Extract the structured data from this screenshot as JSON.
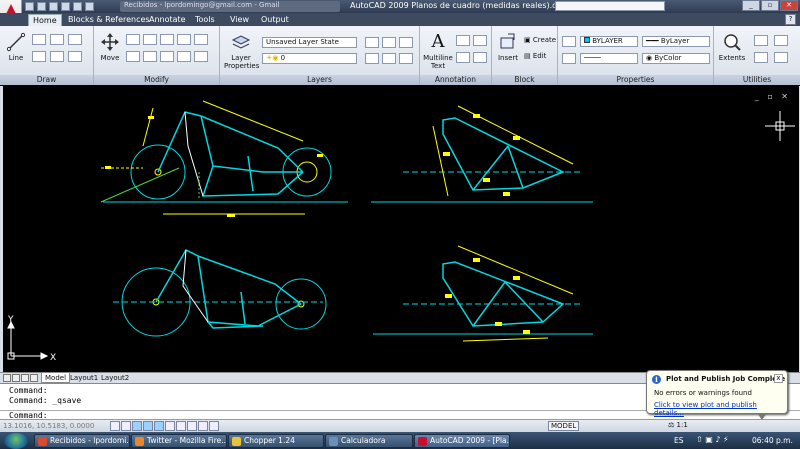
{
  "window": {
    "title": "AutoCAD 2009 Planos de cuadro (medidas reales).dwg",
    "background_task": "Recibidos - lpordomingo@gmail.com - Gmail"
  },
  "ribbon_tabs": [
    "Home",
    "Blocks & References",
    "Annotate",
    "Tools",
    "View",
    "Output"
  ],
  "help_label": "?",
  "ribbon": {
    "panels": {
      "draw": "Draw",
      "modify": "Modify",
      "layers": "Layers",
      "annotation": "Annotation",
      "block": "Block",
      "properties": "Properties",
      "utilities": "Utilities"
    },
    "line_label": "Line",
    "move_label": "Move",
    "layer_properties_label": "Layer\nProperties",
    "layer_state": "Unsaved Layer State",
    "current_layer": "0",
    "multiline_text_label": "Multiline\nText",
    "insert_label": "Insert",
    "create_label": "Create",
    "edit_label": "Edit",
    "color": "BYLAYER",
    "linetype": "ByLayer",
    "lineweight": "ByColor",
    "extents_label": "Extents"
  },
  "viewport_controls": "_ ▫ ✕",
  "axes": {
    "x": "X",
    "y": "Y"
  },
  "layout_tabs": [
    "Model",
    "Layout1",
    "Layout2"
  ],
  "command_history": [
    "Command:",
    "Command: _qsave"
  ],
  "command_prompt": "Command:",
  "status": {
    "coordinates": "13.1016, 10.5183, 0.0000",
    "model_label": "MODEL",
    "annotation_scale": "1:1"
  },
  "notification": {
    "title": "Plot and Publish Job Complete",
    "message": "No errors or warnings found",
    "link": "Click to view plot and publish details...",
    "close": "x"
  },
  "taskbar": {
    "items": [
      {
        "label": "Recibidos - lpordomi...",
        "color": "#d94a2f"
      },
      {
        "label": "Twitter - Mozilla Fire...",
        "color": "#e8872b"
      },
      {
        "label": "Chopper 1.24",
        "color": "#e7c23c"
      },
      {
        "label": "Calculadora",
        "color": "#6c8fb8"
      },
      {
        "label": "AutoCAD 2009 - [Pla...",
        "color": "#c8102e"
      }
    ],
    "language": "ES",
    "clock": "06:40 p.m."
  },
  "colors": {
    "cyan": "#00d8e0",
    "yellow": "#ffff00",
    "white": "#ffffff",
    "green": "#4cd64c",
    "autodesk_red": "#c8102e"
  }
}
